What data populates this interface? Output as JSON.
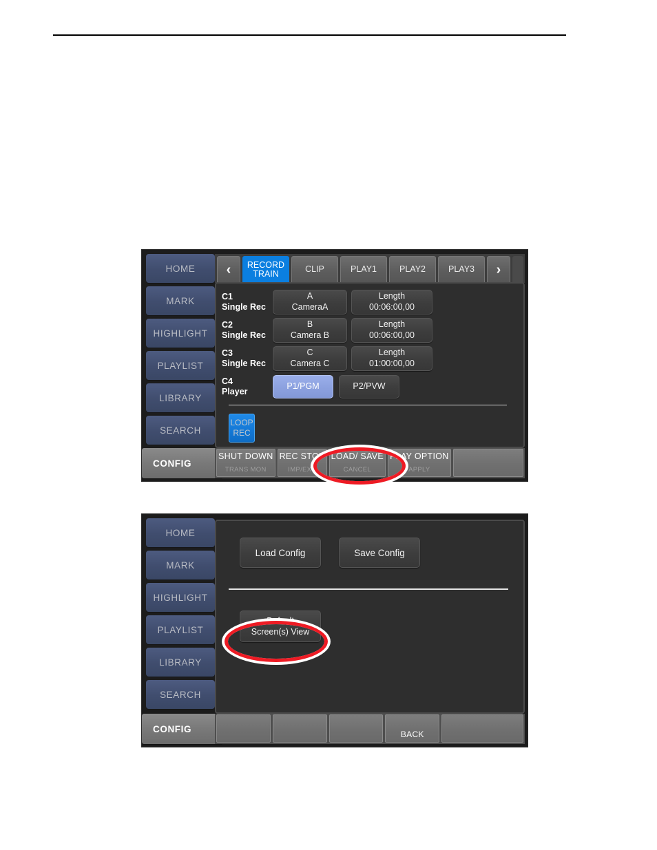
{
  "panel_one": {
    "sidebar": [
      {
        "label": "HOME"
      },
      {
        "label": "MARK"
      },
      {
        "label": "HIGHLIGHT"
      },
      {
        "label": "PLAYLIST"
      },
      {
        "label": "LIBRARY"
      },
      {
        "label": "SEARCH"
      },
      {
        "label": "CONFIG"
      }
    ],
    "tabs": {
      "prev_arrow": "‹",
      "next_arrow": "›",
      "items": [
        {
          "label": "RECORD\nTRAIN",
          "line1": "RECORD",
          "line2": "TRAIN",
          "active": true
        },
        {
          "label": "CLIP",
          "line1": "CLIP",
          "line2": "",
          "active": false
        },
        {
          "label": "PLAY1",
          "line1": "PLAY1",
          "line2": "",
          "active": false
        },
        {
          "label": "PLAY2",
          "line1": "PLAY2",
          "line2": "",
          "active": false
        },
        {
          "label": "PLAY3",
          "line1": "PLAY3",
          "line2": "",
          "active": false
        }
      ]
    },
    "channels": [
      {
        "id": "C1",
        "mode": "Single Rec",
        "source_line1": "A",
        "source_line2": "CameraA",
        "length_line1": "Length",
        "length_line2": "00:06:00,00"
      },
      {
        "id": "C2",
        "mode": "Single Rec",
        "source_line1": "B",
        "source_line2": "Camera B",
        "length_line1": "Length",
        "length_line2": "00:06:00,00"
      },
      {
        "id": "C3",
        "mode": "Single Rec",
        "source_line1": "C",
        "source_line2": "Camera C",
        "length_line1": "Length",
        "length_line2": "01:00:00,00"
      }
    ],
    "player_row": {
      "id": "C4",
      "mode": "Player",
      "buttons": [
        {
          "label": "P1/PGM",
          "selected": true
        },
        {
          "label": "P2/PVW",
          "selected": false
        }
      ]
    },
    "loop_rec": {
      "line1": "LOOP",
      "line2": "REC"
    },
    "softkeys": [
      {
        "top": "SHUT DOWN",
        "bottom": "TRANS MON"
      },
      {
        "top": "REC STOP",
        "bottom": "IMP/EXP"
      },
      {
        "top": "LOAD/ SAVE",
        "bottom": "CANCEL"
      },
      {
        "top": "PLAY OPTION",
        "bottom": "APPLY"
      },
      {
        "top": "",
        "bottom": ""
      }
    ]
  },
  "panel_two": {
    "sidebar": [
      {
        "label": "HOME"
      },
      {
        "label": "MARK"
      },
      {
        "label": "HIGHLIGHT"
      },
      {
        "label": "PLAYLIST"
      },
      {
        "label": "LIBRARY"
      },
      {
        "label": "SEARCH"
      },
      {
        "label": "CONFIG"
      }
    ],
    "config_buttons": [
      {
        "label": "Load Config"
      },
      {
        "label": "Save Config"
      }
    ],
    "default_view_button": {
      "line1": "Default",
      "line2": "Screen(s) View"
    },
    "softkeys": [
      {
        "top": "",
        "bottom": ""
      },
      {
        "top": "",
        "bottom": ""
      },
      {
        "top": "",
        "bottom": ""
      },
      {
        "top": "",
        "bottom": "BACK"
      },
      {
        "top": "",
        "bottom": ""
      }
    ]
  },
  "annotations": [
    {
      "name": "load-save-highlight",
      "color": "#ee1b24",
      "target": "LOAD/ SAVE"
    },
    {
      "name": "default-screens-view-highlight",
      "color": "#ee1b24",
      "target": "Default Screen(s) View"
    }
  ],
  "colors": {
    "accent_blue": "#0b7fe0",
    "selected_blue": "#8ba0de",
    "rail_blue": "#404d6e",
    "annotation_red": "#ee1b24",
    "panel_bg": "#2e2e2e"
  }
}
